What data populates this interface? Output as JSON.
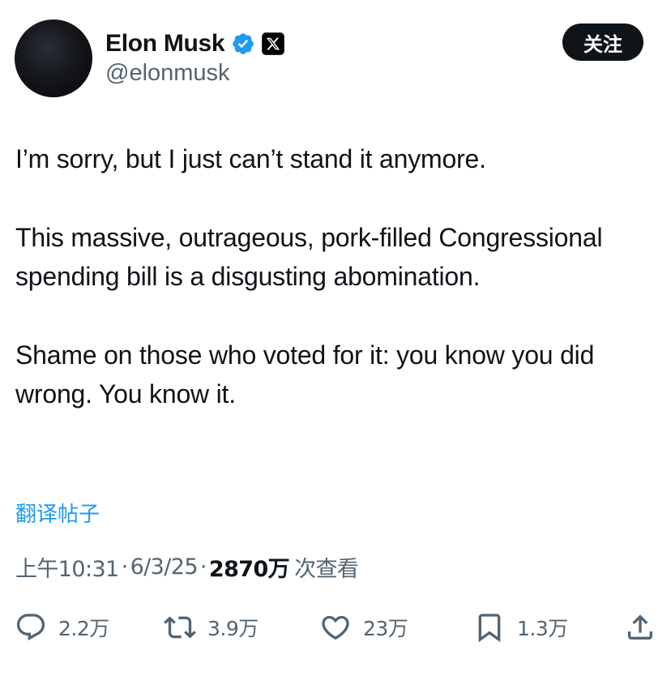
{
  "author": {
    "display_name": "Elon Musk",
    "handle": "@elonmusk",
    "verified_icon": "verified-badge-icon",
    "affiliation_icon": "x-logo-icon"
  },
  "follow_button": {
    "label": "关注"
  },
  "tweet": {
    "paragraphs": [
      "I’m sorry, but I just can’t stand it anymore.",
      "This massive, outrageous, pork-filled Congressional spending bill is a disgusting abomination.",
      "Shame on those who voted for it: you know you did wrong. You know it."
    ]
  },
  "translate_link": "翻译帖子",
  "meta": {
    "time": "上午10:31",
    "separator": "·",
    "date": "6/3/25",
    "views_count": "2870万",
    "views_label": "次查看"
  },
  "actions": {
    "reply": {
      "icon": "reply-icon",
      "count": "2.2万"
    },
    "retweet": {
      "icon": "retweet-icon",
      "count": "3.9万"
    },
    "like": {
      "icon": "heart-icon",
      "count": "23万"
    },
    "bookmark": {
      "icon": "bookmark-icon",
      "count": "1.3万"
    },
    "share": {
      "icon": "share-icon"
    }
  },
  "colors": {
    "text_primary": "#0f1419",
    "text_secondary": "#536471",
    "link_blue": "#1d9bf0",
    "button_dark": "#0f1419"
  }
}
